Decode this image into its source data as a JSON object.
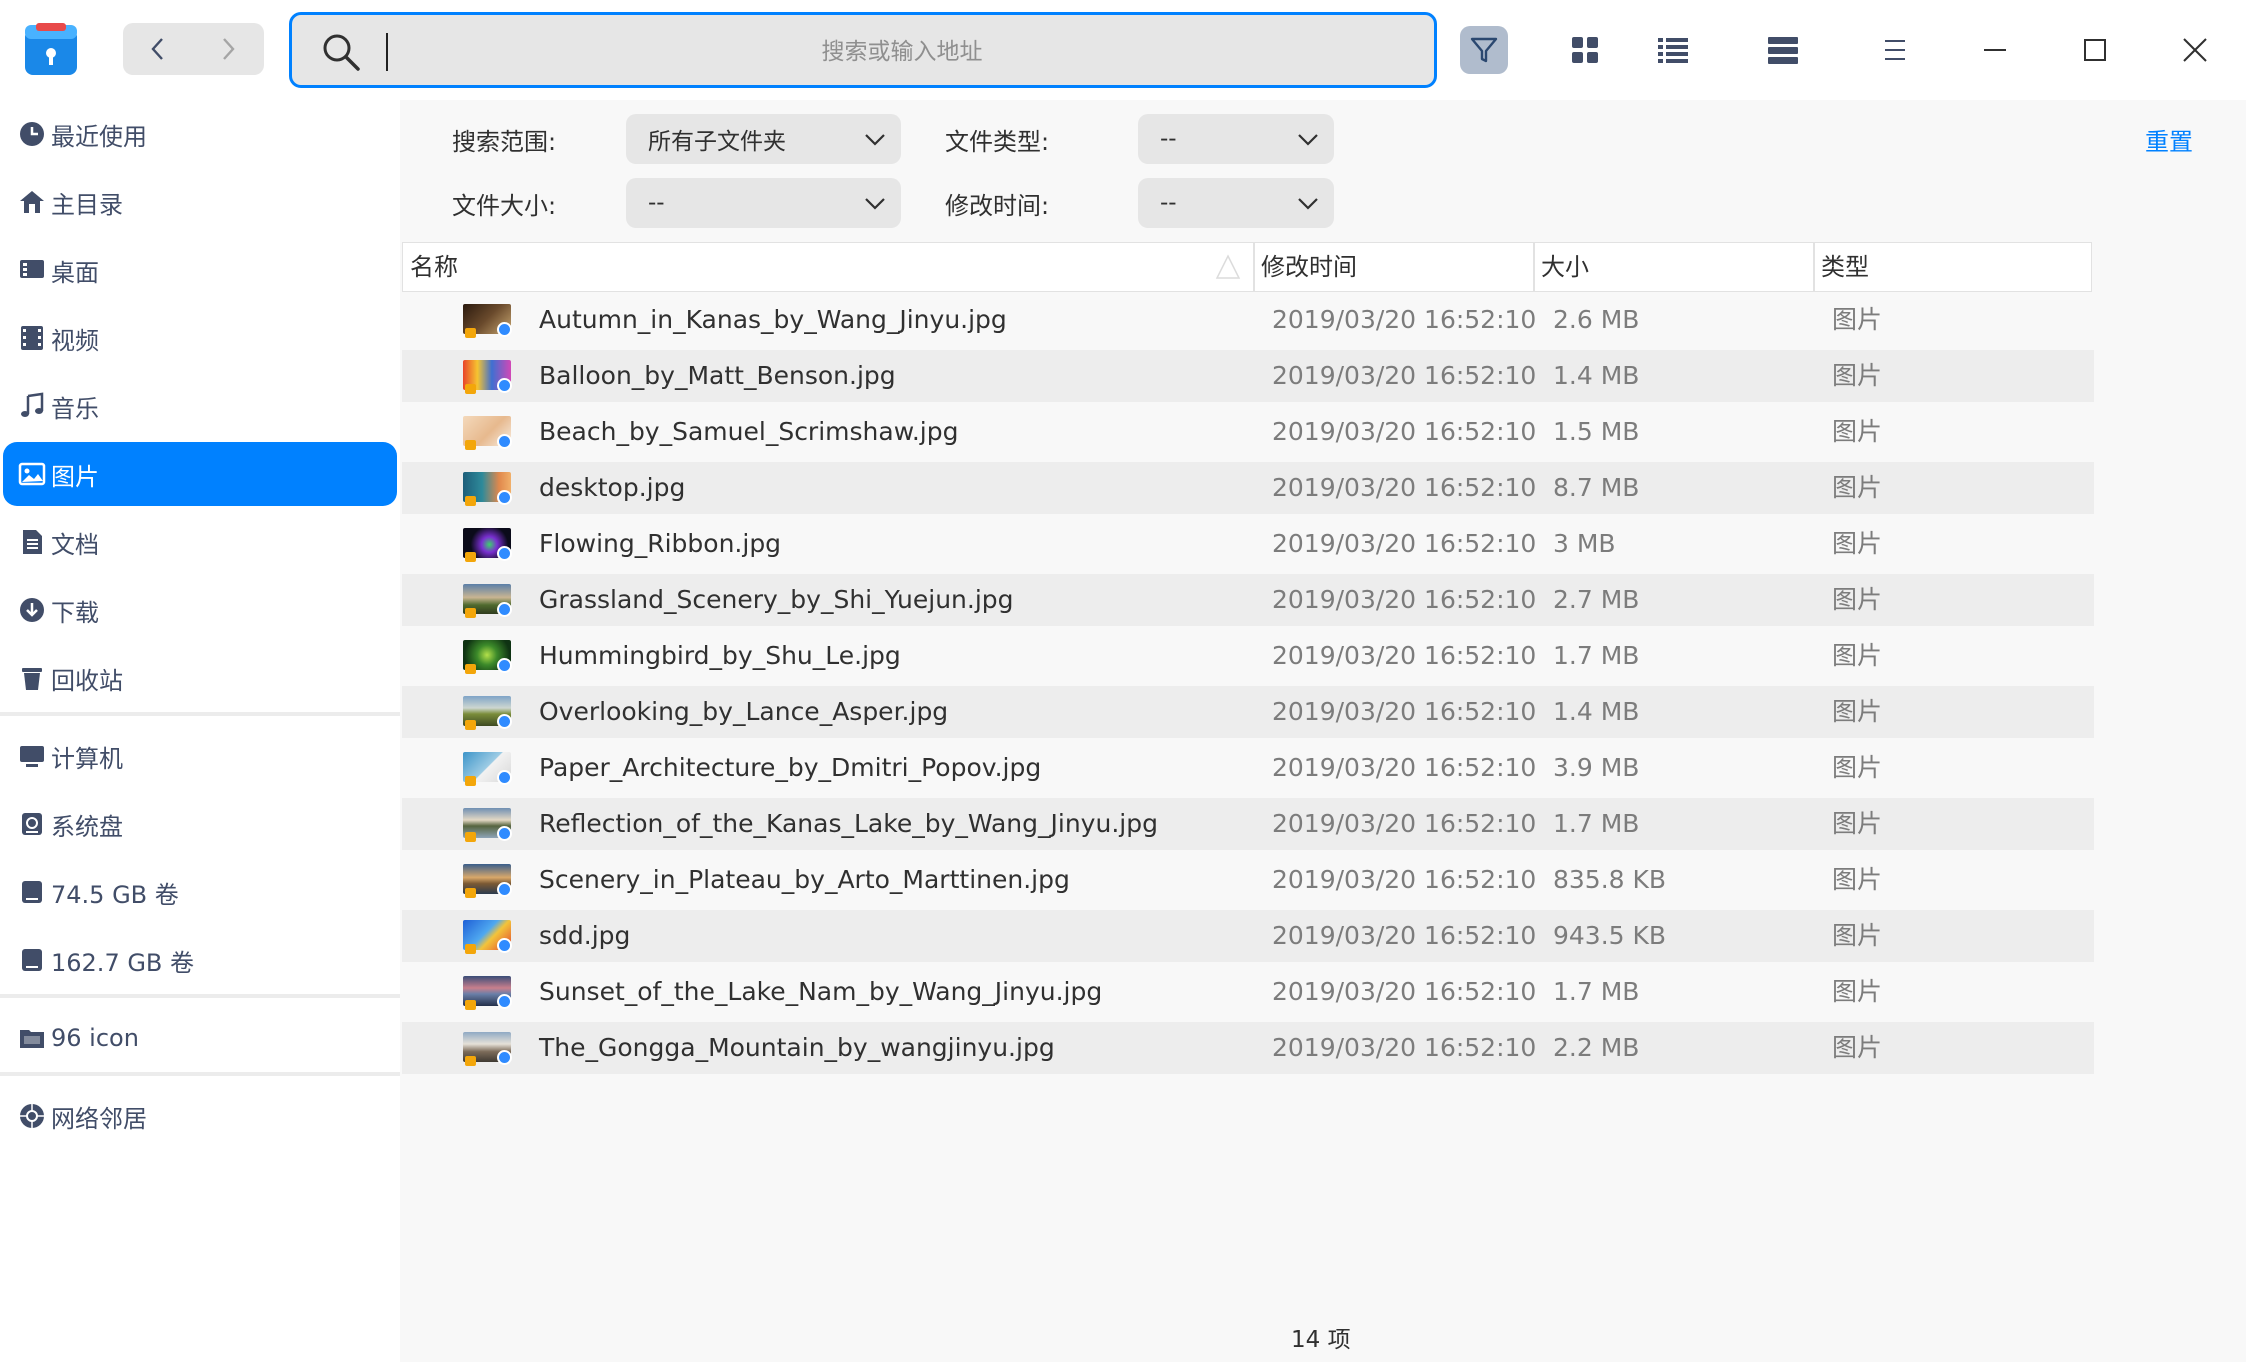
{
  "search": {
    "placeholder": "搜索或输入地址",
    "value": ""
  },
  "sidebar": {
    "items": [
      {
        "label": "最近使用",
        "icon": "clock-icon"
      },
      {
        "label": "主目录",
        "icon": "home-icon"
      },
      {
        "label": "桌面",
        "icon": "desktop-icon"
      },
      {
        "label": "视频",
        "icon": "video-icon"
      },
      {
        "label": "音乐",
        "icon": "music-icon"
      },
      {
        "label": "图片",
        "icon": "picture-icon",
        "active": true
      },
      {
        "label": "文档",
        "icon": "document-icon"
      },
      {
        "label": "下载",
        "icon": "download-icon"
      },
      {
        "label": "回收站",
        "icon": "trash-icon"
      }
    ],
    "devices": [
      {
        "label": "计算机",
        "icon": "computer-icon"
      },
      {
        "label": "系统盘",
        "icon": "system-disk-icon"
      },
      {
        "label": "74.5 GB 卷",
        "icon": "drive-icon"
      },
      {
        "label": "162.7 GB 卷",
        "icon": "drive-icon"
      }
    ],
    "bookmarks": [
      {
        "label": "96 icon",
        "icon": "folder-icon"
      }
    ],
    "network": [
      {
        "label": "网络邻居",
        "icon": "network-icon"
      }
    ]
  },
  "filters": {
    "scope_label": "搜索范围:",
    "scope_value": "所有子文件夹",
    "type_label": "文件类型:",
    "type_value": "--",
    "size_label": "文件大小:",
    "size_value": "--",
    "time_label": "修改时间:",
    "time_value": "--",
    "reset": "重置"
  },
  "table": {
    "columns": [
      "名称",
      "修改时间",
      "大小",
      "类型"
    ],
    "rows": [
      {
        "name": "Autumn_in_Kanas_by_Wang_Jinyu.jpg",
        "modified": "2019/03/20 16:52:10",
        "size": "2.6 MB",
        "type": "图片"
      },
      {
        "name": "Balloon_by_Matt_Benson.jpg",
        "modified": "2019/03/20 16:52:10",
        "size": "1.4 MB",
        "type": "图片"
      },
      {
        "name": "Beach_by_Samuel_Scrimshaw.jpg",
        "modified": "2019/03/20 16:52:10",
        "size": "1.5 MB",
        "type": "图片"
      },
      {
        "name": "desktop.jpg",
        "modified": "2019/03/20 16:52:10",
        "size": "8.7 MB",
        "type": "图片"
      },
      {
        "name": "Flowing_Ribbon.jpg",
        "modified": "2019/03/20 16:52:10",
        "size": "3 MB",
        "type": "图片"
      },
      {
        "name": "Grassland_Scenery_by_Shi_Yuejun.jpg",
        "modified": "2019/03/20 16:52:10",
        "size": "2.7 MB",
        "type": "图片"
      },
      {
        "name": "Hummingbird_by_Shu_Le.jpg",
        "modified": "2019/03/20 16:52:10",
        "size": "1.7 MB",
        "type": "图片"
      },
      {
        "name": "Overlooking_by_Lance_Asper.jpg",
        "modified": "2019/03/20 16:52:10",
        "size": "1.4 MB",
        "type": "图片"
      },
      {
        "name": "Paper_Architecture_by_Dmitri_Popov.jpg",
        "modified": "2019/03/20 16:52:10",
        "size": "3.9 MB",
        "type": "图片"
      },
      {
        "name": "Reflection_of_the_Kanas_Lake_by_Wang_Jinyu.jpg",
        "modified": "2019/03/20 16:52:10",
        "size": "1.7 MB",
        "type": "图片"
      },
      {
        "name": "Scenery_in_Plateau_by_Arto_Marttinen.jpg",
        "modified": "2019/03/20 16:52:10",
        "size": "835.8 KB",
        "type": "图片"
      },
      {
        "name": "sdd.jpg",
        "modified": "2019/03/20 16:52:10",
        "size": "943.5 KB",
        "type": "图片"
      },
      {
        "name": "Sunset_of_the_Lake_Nam_by_Wang_Jinyu.jpg",
        "modified": "2019/03/20 16:52:10",
        "size": "1.7 MB",
        "type": "图片"
      },
      {
        "name": "The_Gongga_Mountain_by_wangjinyu.jpg",
        "modified": "2019/03/20 16:52:10",
        "size": "2.2 MB",
        "type": "图片"
      }
    ]
  },
  "status": {
    "count": "14 项"
  },
  "colors": {
    "accent": "#0081ff",
    "sidebar_text": "#414d68",
    "row_alt": "#ededed"
  }
}
